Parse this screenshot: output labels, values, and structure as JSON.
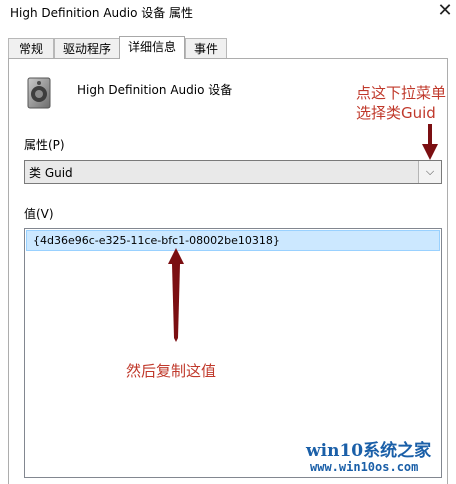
{
  "window": {
    "title": "High Definition Audio 设备 属性",
    "close_icon": "close-icon"
  },
  "tabs": [
    {
      "label": "常规"
    },
    {
      "label": "驱动程序"
    },
    {
      "label": "详细信息",
      "active": true
    },
    {
      "label": "事件"
    }
  ],
  "device": {
    "icon": "speaker-icon",
    "name": "High Definition Audio 设备"
  },
  "property": {
    "label": "属性(P)",
    "selected": "类 Guid"
  },
  "value": {
    "label": "值(V)",
    "rows": [
      "{4d36e96c-e325-11ce-bfc1-08002be10318}"
    ]
  },
  "annotations": {
    "dropdown_hint_line1": "点这下拉菜单",
    "dropdown_hint_line2": "选择类Guid",
    "copy_hint": "然后复制这值",
    "color": "#c0392b",
    "arrow_color": "#7b0f12"
  },
  "watermark": {
    "line1": "win10系统之家",
    "line2": "www.win10os.com",
    "color": "#1a5fa8"
  }
}
